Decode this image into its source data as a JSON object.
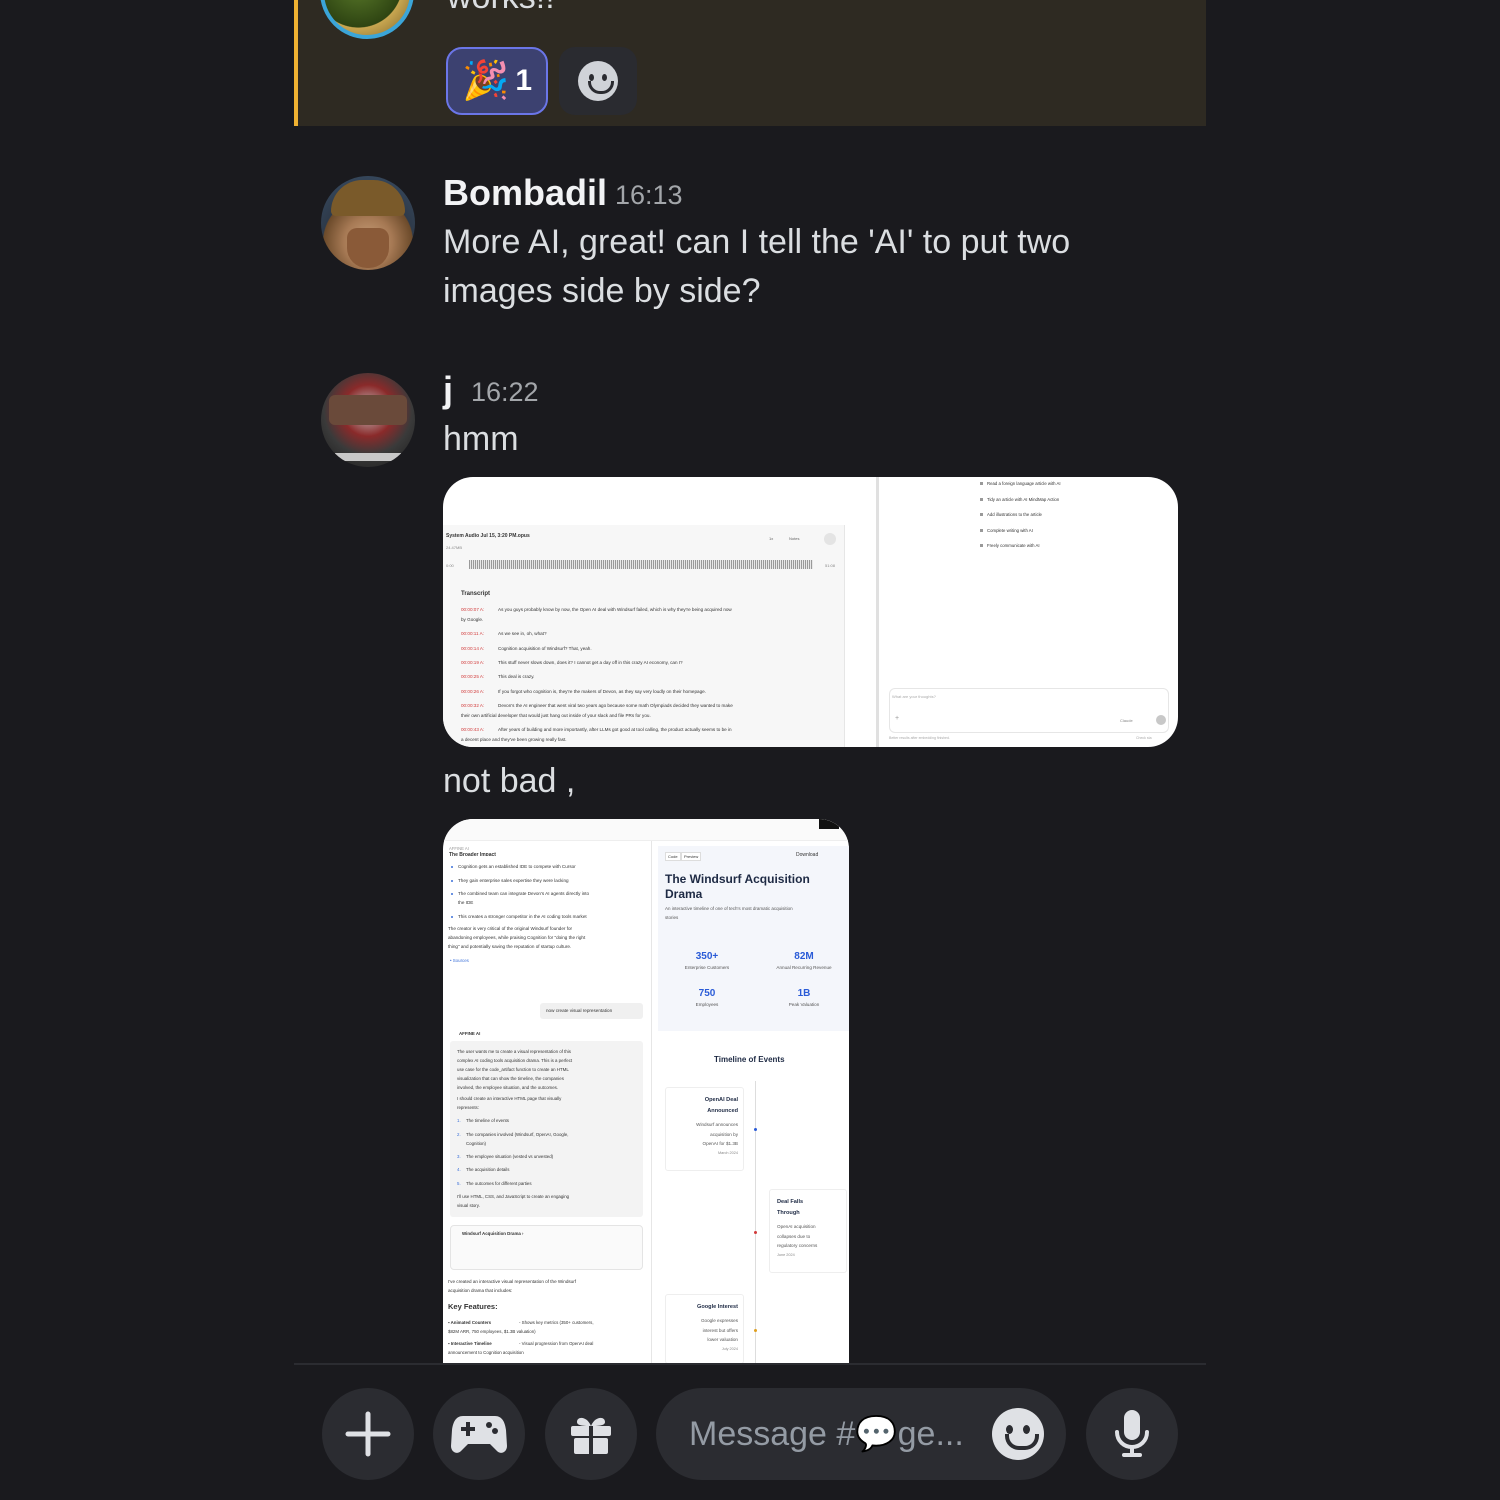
{
  "highlighted_message": {
    "text": "works!!",
    "reactions": [
      {
        "emoji": "🎉",
        "count": "1",
        "active": true
      },
      {
        "icon": "add-reaction-icon"
      }
    ]
  },
  "messages": [
    {
      "author": "Bombadil",
      "time": "16:13",
      "text_line1": "More AI, great!  can I tell the 'AI' to put two",
      "text_line2": "images side by side?"
    },
    {
      "author": "j",
      "time": "16:22",
      "text": "hmm",
      "text_after_image": "not bad ,"
    }
  ],
  "embed1": {
    "audio_title": "System Audio Jul 15, 3:20 PM.opus",
    "file_size": "24.47MB",
    "start_time": "0:00",
    "end_time": "51:08",
    "speed": "1x",
    "notes": "Notes",
    "transcript_heading": "Transcript",
    "lines": [
      {
        "t": "00:00:07 A:",
        "text": "As you guys probably know by now, the Open AI deal with Windsurf failed, which is why they're being acquired now"
      },
      {
        "t": "",
        "text": "by Google."
      },
      {
        "t": "00:00:11 A:",
        "text": "As we see in, oh, what?"
      },
      {
        "t": "00:00:14 A:",
        "text": "Cognition acquisition of Windsurf? That, yeah."
      },
      {
        "t": "00:00:19 A:",
        "text": "This stuff never slows down, does it? I cannot get a day off in this crazy AI economy, can I?"
      },
      {
        "t": "00:00:25 A:",
        "text": "This deal is crazy."
      },
      {
        "t": "00:00:26 A:",
        "text": "If you forgot who cognition is, they're the makers of Devon, as they say very loudly on their homepage."
      },
      {
        "t": "00:00:32 A:",
        "text": "Devon's the AI engineer that went viral two years ago because some math Olympiads decided they wanted to make"
      },
      {
        "t": "",
        "text": "their own artificial developer that would just hang out inside of your slack and file PRs for you."
      },
      {
        "t": "00:00:43 A:",
        "text": "After years of building and more importantly, after LLMs got good at tool calling, the product actually seems to be in"
      },
      {
        "t": "",
        "text": "a decent place and they've been growing really fast."
      }
    ],
    "menu": [
      "Read a foreign language article with AI",
      "Tidy an article with AI MindMap Action",
      "Add illustrations to the article",
      "Complete writing with AI",
      "Freely communicate with AI"
    ],
    "chat_placeholder": "What are your thoughts?",
    "model": "Claude",
    "footer_left": "Better results after embedding finished.",
    "footer_right": "Check sta"
  },
  "embed2": {
    "left": {
      "header": "AFFINE AI",
      "cut_heading": "The Broader Impact",
      "bullets": [
        "Cognition gets an established IDE to compete with Cursor",
        "They gain enterprise sales expertise they were lacking",
        "The combined team can integrate Devon's AI agents directly into",
        "the IDE",
        "This creates a stronger competitor in the AI coding tools market"
      ],
      "para": [
        "The creator is very critical of the original Windsurf founder for",
        "abandoning employees, while praising Cognition for \"doing the right",
        "thing\" and potentially saving the reputation of startup culture."
      ],
      "sources": "Sources",
      "user_msg": "now create visual representation",
      "ai_label": "AFFINE AI",
      "think": [
        "The user wants me to create a visual representation of this",
        "complex AI coding tools acquisition drama. This is a perfect",
        "use case for the code_artifact function to create an HTML",
        "visualization that can show the timeline, the companies",
        "involved, the employee situation, and the outcomes."
      ],
      "think2": [
        "I should create an interactive HTML page that visually",
        "represents:"
      ],
      "list": [
        "The timeline of events",
        "The companies involved (Windsurf, OpenAI, Google,",
        "Cognition)",
        "The employee situation (vested vs unvested)",
        "The acquisition details",
        "The outcomes for different parties"
      ],
      "think3": [
        "I'll use HTML, CSS, and JavaScript to create an engaging",
        "visual story."
      ],
      "artifact": "Windsurf Acquisition Drama",
      "created": [
        "I've created an interactive visual representation of the Windsurf",
        "acquisition drama that includes:"
      ],
      "key_features": "Key Features:",
      "kf1a": "Animated Counters",
      "kf1b": "- Shows key metrics (350+ customers,",
      "kf1c": "$82M ARR, 750 employees, $1.3B valuation)",
      "kf2a": "Interactive Timeline",
      "kf2b": "- Visual progression from OpenAI deal",
      "kf2c": "announcement to Cognition acquisition"
    },
    "right": {
      "tab_code": "Code",
      "tab_preview": "Preview",
      "download": "Download",
      "title1": "The Windsurf Acquisition",
      "title2": "Drama",
      "subtitle1": "An interactive timeline of one of tech's most dramatic acquisition",
      "subtitle2": "stories",
      "stats": [
        {
          "value": "350+",
          "label": "Enterprise Customers"
        },
        {
          "value": "82M",
          "label": "Annual Recurring Revenue"
        },
        {
          "value": "750",
          "label": "Employees"
        },
        {
          "value": "1B",
          "label": "Peak Valuation"
        }
      ],
      "timeline_title": "Timeline of Events",
      "events": [
        {
          "title1": "OpenAI Deal",
          "title2": "Announced",
          "d1": "Windsurf announces",
          "d2": "acquisition by",
          "d3": "OpenAI for $1.3B",
          "date": "March 2024"
        },
        {
          "title1": "Deal Falls",
          "title2": "Through",
          "d1": "OpenAI acquisition",
          "d2": "collapses due to",
          "d3": "regulatory concerns",
          "date": "June 2024"
        },
        {
          "title1": "Google Interest",
          "title2": "",
          "d1": "Google expresses",
          "d2": "interest but offers",
          "d3": "lower valuation",
          "date": "July 2024"
        }
      ]
    }
  },
  "composer": {
    "placeholder": "Message #💬ge...",
    "colors": {
      "accent": "#5865f2",
      "highlight_bar": "#f0b232",
      "bg": "#1a1a1e",
      "input_bg": "#2b2c31"
    }
  }
}
